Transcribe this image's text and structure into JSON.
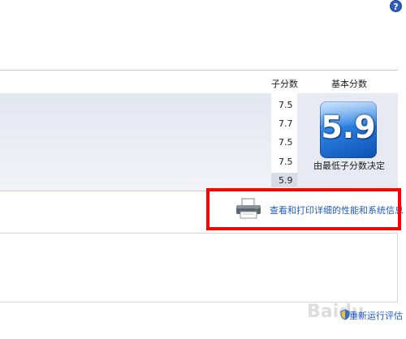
{
  "help_icon": "?",
  "table": {
    "col_subscore": "子分数",
    "col_basescore": "基本分数",
    "subscores": [
      "7.5",
      "7.7",
      "7.5",
      "7.5",
      "5.9"
    ],
    "base_score": "5.9",
    "base_caption": "由最低子分数决定"
  },
  "print_link": "查看和打印详细的性能和系统信息",
  "rerun_link": "重新运行评估",
  "watermark": "Baidu",
  "colors": {
    "highlight_box": "#ff0000",
    "link": "#1f5bc6",
    "badge": "#2a7fe0"
  }
}
